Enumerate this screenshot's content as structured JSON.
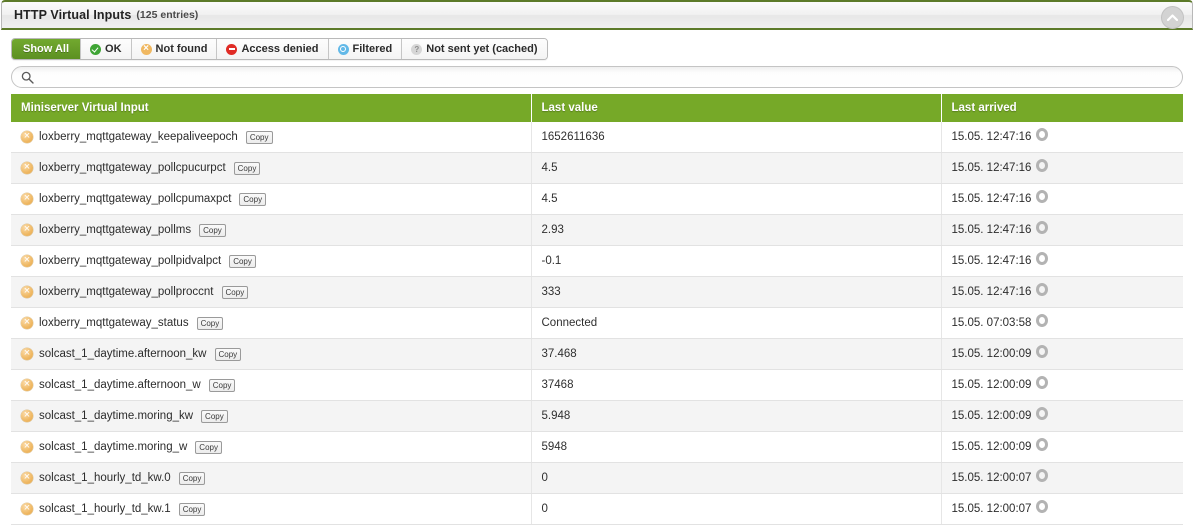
{
  "panel": {
    "title": "HTTP Virtual Inputs",
    "subtitle": "(125 entries)",
    "collapse_icon": "chevron-up-icon",
    "accent_green": "#76a928",
    "header_border_green": "#5c7a29"
  },
  "filters": [
    {
      "label": "Show All",
      "icon": "",
      "active": true
    },
    {
      "label": "OK",
      "icon": "check-circle-icon",
      "icon_class": "ico-ok",
      "icon_color": "#3fa535",
      "active": false
    },
    {
      "label": "Not found",
      "icon": "x-circle-icon",
      "icon_class": "ico-notfound",
      "icon_color": "#f0b861",
      "active": false
    },
    {
      "label": "Access denied",
      "icon": "denied-circle-icon",
      "icon_class": "ico-denied",
      "icon_color": "#e02b25",
      "active": false
    },
    {
      "label": "Filtered",
      "icon": "filter-circle-icon",
      "icon_class": "ico-filtered",
      "icon_color": "#63b9e8",
      "active": false
    },
    {
      "label": "Not sent yet (cached)",
      "icon": "question-circle-icon",
      "icon_class": "ico-cached",
      "icon_color": "#d6d6d6",
      "active": false
    }
  ],
  "search": {
    "value": "",
    "placeholder": "",
    "icon": "search-icon"
  },
  "table": {
    "columns": [
      "Miniserver Virtual Input",
      "Last value",
      "Last arrived"
    ],
    "copy_label": "Copy",
    "status_icon": "not-found-icon",
    "arrived_icon": "loading-spinner-icon",
    "rows": [
      {
        "name": "loxberry_mqttgateway_keepaliveepoch",
        "value": "1652611636",
        "arrived": "15.05. 12:47:16"
      },
      {
        "name": "loxberry_mqttgateway_pollcpucurpct",
        "value": "4.5",
        "arrived": "15.05. 12:47:16"
      },
      {
        "name": "loxberry_mqttgateway_pollcpumaxpct",
        "value": "4.5",
        "arrived": "15.05. 12:47:16"
      },
      {
        "name": "loxberry_mqttgateway_pollms",
        "value": "2.93",
        "arrived": "15.05. 12:47:16"
      },
      {
        "name": "loxberry_mqttgateway_pollpidvalpct",
        "value": "-0.1",
        "arrived": "15.05. 12:47:16"
      },
      {
        "name": "loxberry_mqttgateway_pollproccnt",
        "value": "333",
        "arrived": "15.05. 12:47:16"
      },
      {
        "name": "loxberry_mqttgateway_status",
        "value": "Connected",
        "arrived": "15.05. 07:03:58"
      },
      {
        "name": "solcast_1_daytime.afternoon_kw",
        "value": "37.468",
        "arrived": "15.05. 12:00:09"
      },
      {
        "name": "solcast_1_daytime.afternoon_w",
        "value": "37468",
        "arrived": "15.05. 12:00:09"
      },
      {
        "name": "solcast_1_daytime.moring_kw",
        "value": "5.948",
        "arrived": "15.05. 12:00:09"
      },
      {
        "name": "solcast_1_daytime.moring_w",
        "value": "5948",
        "arrived": "15.05. 12:00:09"
      },
      {
        "name": "solcast_1_hourly_td_kw.0",
        "value": "0",
        "arrived": "15.05. 12:00:07"
      },
      {
        "name": "solcast_1_hourly_td_kw.1",
        "value": "0",
        "arrived": "15.05. 12:00:07"
      }
    ]
  }
}
